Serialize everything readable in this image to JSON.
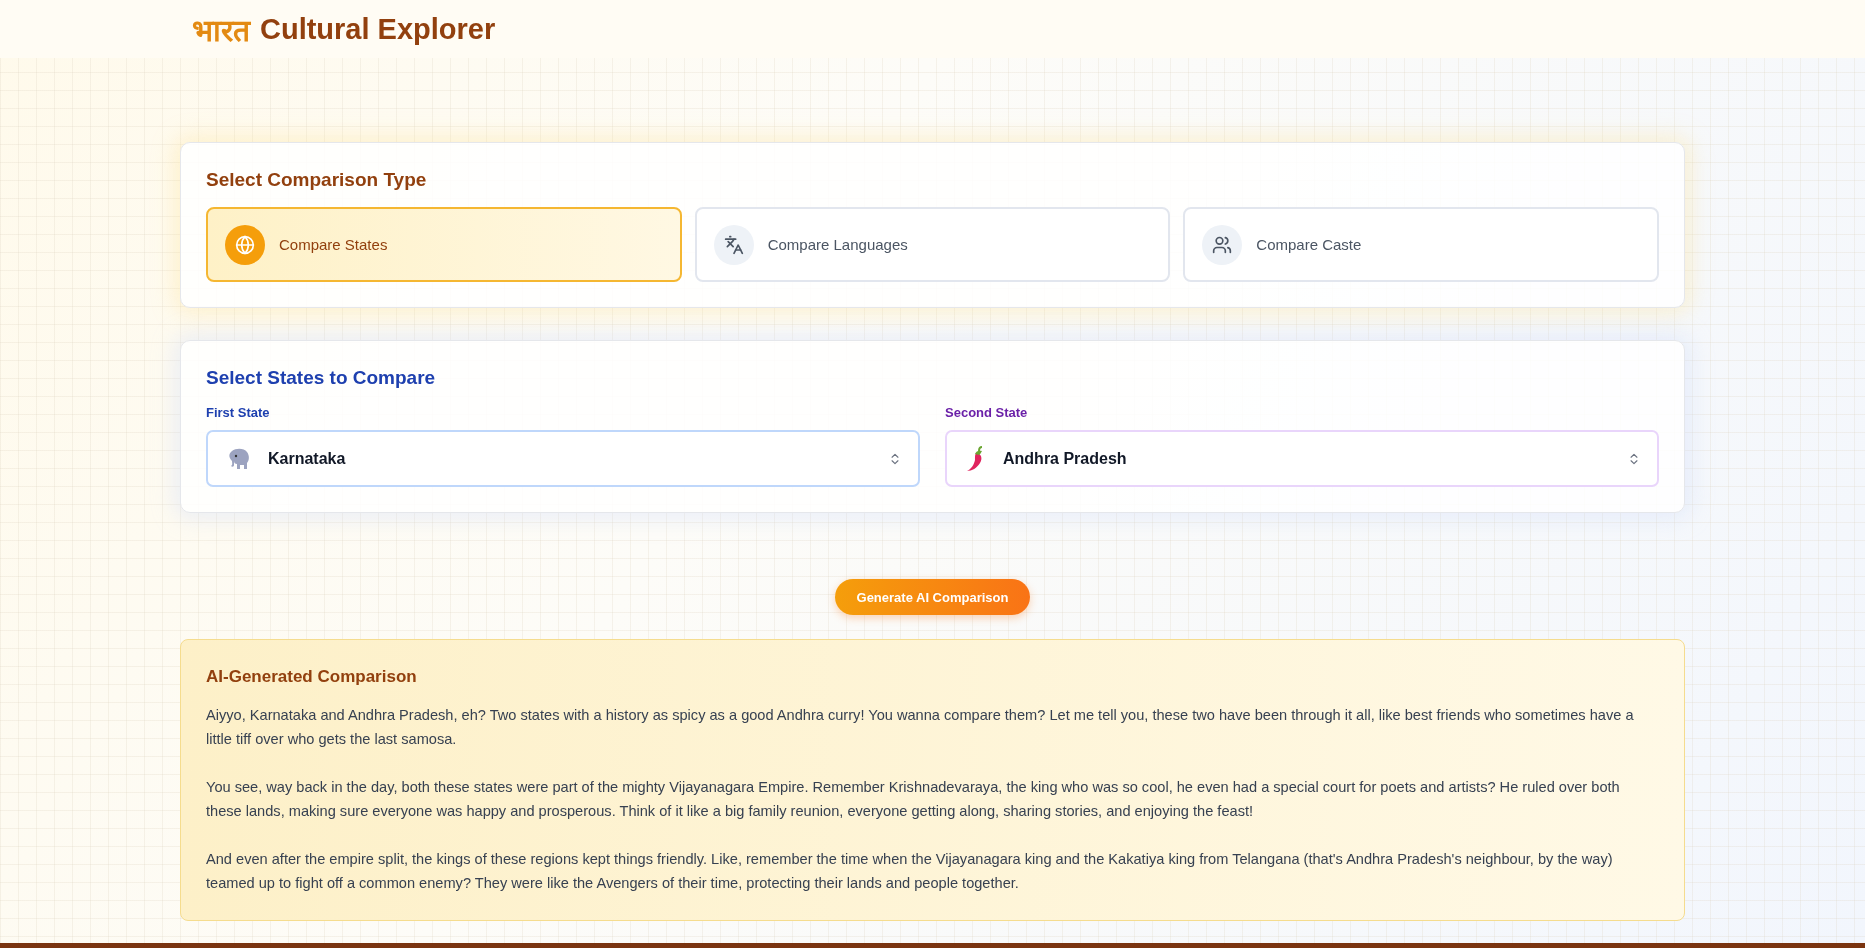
{
  "header": {
    "brand_accent": "भारत",
    "brand_title": "Cultural Explorer"
  },
  "comparison_type": {
    "title": "Select Comparison Type",
    "options": [
      {
        "kind": "states",
        "label": "Compare States",
        "selected": true
      },
      {
        "kind": "languages",
        "label": "Compare Languages",
        "selected": false
      },
      {
        "kind": "caste",
        "label": "Compare Caste",
        "selected": false
      }
    ]
  },
  "state_select": {
    "title": "Select States to Compare",
    "fields": [
      {
        "kind": "first",
        "label": "First State",
        "value": "Karnataka"
      },
      {
        "kind": "second",
        "label": "Second State",
        "value": "Andhra Pradesh"
      }
    ]
  },
  "generate_button": "Generate AI Comparison",
  "result": {
    "title": "AI-Generated Comparison",
    "paragraphs": [
      "Aiyyo, Karnataka and Andhra Pradesh, eh?  Two states with a history as spicy as a good Andhra curry!  You wanna compare them?  Let me tell you, these two have been through it all, like best friends who sometimes have a little tiff over who gets the last samosa.",
      "You see, way back in the day, both these states were part of the mighty Vijayanagara Empire.  Remember Krishnadevaraya, the king who was so cool, he even had a special court for poets and artists?  He ruled over both these lands, making sure everyone was happy and prosperous.  Think of it like a big family reunion, everyone getting along, sharing stories, and enjoying the feast!",
      "And even after the empire split, the kings of these regions kept things friendly.  Like, remember the time when the Vijayanagara king and the Kakatiya king from Telangana (that's Andhra Pradesh's neighbour, by the way) teamed up to fight off a common enemy?  They were like the Avengers of their time, protecting their lands and people together."
    ]
  }
}
